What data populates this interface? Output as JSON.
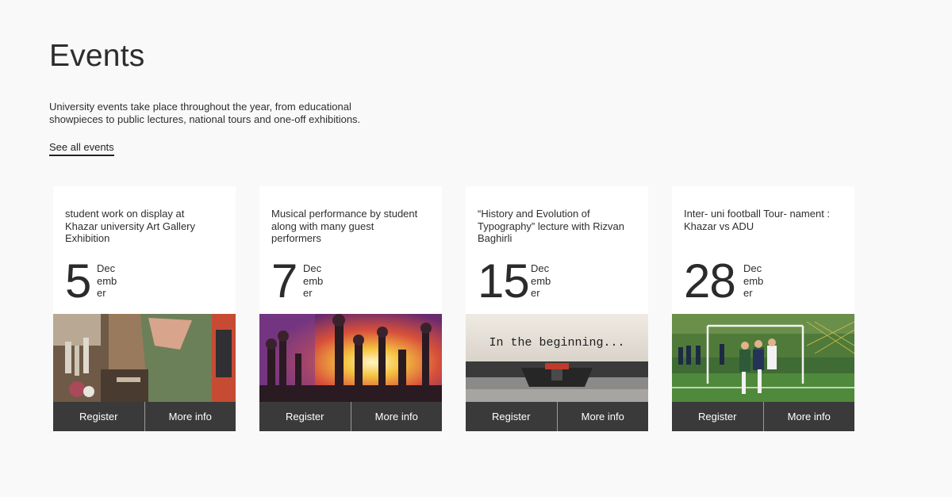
{
  "header": {
    "title": "Events",
    "intro": "University events take place throughout the year, from educational showpieces to public lectures, national tours and one-off exhibitions.",
    "see_all": "See all events"
  },
  "events": [
    {
      "title": "student work on display at Khazar university Art Gallery Exhibition",
      "day": "5",
      "month": "December",
      "register_label": "Register",
      "more_info_label": "More info",
      "image": "art-studio-photo"
    },
    {
      "title": "Musical performance by student along with many guest performers",
      "day": "7",
      "month": "December",
      "register_label": "Register",
      "more_info_label": "More info",
      "image": "concert-crowd-photo"
    },
    {
      "title": "“History and Evolution of Typography” lecture with Rizvan Baghirli",
      "day": "15",
      "month": "December",
      "register_label": "Register",
      "more_info_label": "More info",
      "image": "typewriter-photo",
      "image_text": "In the beginning..."
    },
    {
      "title": "Inter- uni football Tour- nament : Khazar vs ADU",
      "day": "28",
      "month": "December",
      "register_label": "Register",
      "more_info_label": "More info",
      "image": "football-match-photo"
    }
  ],
  "colors": {
    "background": "#f9f9f9",
    "card": "#ffffff",
    "action_bar": "#3a3a3a",
    "text": "#2b2b2b"
  }
}
